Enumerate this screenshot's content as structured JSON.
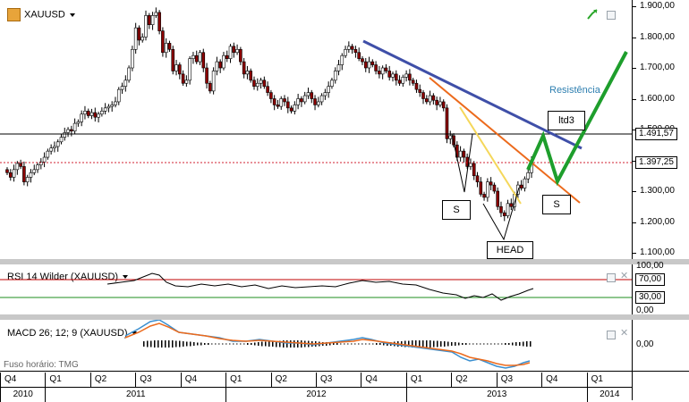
{
  "symbol": "XAUUSD",
  "price_axis": {
    "ticks": [
      {
        "label": "1.900,00",
        "value": 1900
      },
      {
        "label": "1.800,00",
        "value": 1800
      },
      {
        "label": "1.700,00",
        "value": 1700
      },
      {
        "label": "1.600,00",
        "value": 1600
      },
      {
        "label": "1.500,00",
        "value": 1500
      },
      {
        "label": "1.400,00",
        "value": 1400
      },
      {
        "label": "1.300,00",
        "value": 1300
      },
      {
        "label": "1.200,00",
        "value": 1200
      },
      {
        "label": "1.100,00",
        "value": 1100
      }
    ],
    "level_1": "1.491,57",
    "level_2": "1.397,25"
  },
  "annotations": {
    "resistance": "Resistência",
    "ltd": "ltd3",
    "s_left": "S",
    "s_right": "S",
    "head": "HEAD"
  },
  "rsi": {
    "title": "RSI 14 Wilder (XAUUSD)",
    "ticks": [
      "100,00",
      "70,00",
      "30,00",
      "0,00"
    ]
  },
  "macd": {
    "title": "MACD 26; 12; 9 (XAUUSD)",
    "zero_label": "0,00"
  },
  "timezone_label": "Fuso horário: TMG",
  "timeline": {
    "quarters": [
      "Q4",
      "Q1",
      "Q2",
      "Q3",
      "Q4",
      "Q1",
      "Q2",
      "Q3",
      "Q4",
      "Q1",
      "Q2",
      "Q3",
      "Q4",
      "Q1"
    ],
    "years": [
      "2010",
      "2011",
      "2012",
      "2013",
      "2014"
    ]
  },
  "colors": {
    "trend_blue": "#3f4fa8",
    "trend_orange": "#ec6a1c",
    "trend_yellow": "#f5d75a",
    "projection_green": "#1e9e2c",
    "resistance_text": "#2e7fb0",
    "candle_up": "#ffffff",
    "candle_down": "#8b0000",
    "rsi_upper": "#c00000",
    "rsi_lower": "#1e8e1e"
  },
  "chart_data": {
    "type": "candlestick",
    "title": "XAUUSD",
    "xlabel": "",
    "ylabel": "",
    "ylim": [
      1080,
      1920
    ],
    "close": [
      1360,
      1345,
      1370,
      1390,
      1380,
      1330,
      1345,
      1360,
      1370,
      1385,
      1395,
      1410,
      1430,
      1440,
      1445,
      1460,
      1475,
      1490,
      1500,
      1495,
      1520,
      1525,
      1550,
      1560,
      1545,
      1555,
      1540,
      1550,
      1560,
      1570,
      1575,
      1580,
      1590,
      1630,
      1640,
      1660,
      1700,
      1760,
      1830,
      1790,
      1800,
      1870,
      1840,
      1870,
      1880,
      1820,
      1750,
      1780,
      1760,
      1690,
      1710,
      1680,
      1650,
      1660,
      1730,
      1740,
      1720,
      1750,
      1700,
      1650,
      1625,
      1690,
      1720,
      1700,
      1740,
      1730,
      1770,
      1750,
      1760,
      1720,
      1680,
      1690,
      1660,
      1640,
      1650,
      1660,
      1640,
      1620,
      1600,
      1580,
      1575,
      1600,
      1590,
      1570,
      1560,
      1580,
      1600,
      1590,
      1610,
      1620,
      1600,
      1580,
      1590,
      1610,
      1620,
      1640,
      1660,
      1690,
      1710,
      1740,
      1760,
      1770,
      1760,
      1750,
      1730,
      1720,
      1700,
      1720,
      1710,
      1690,
      1680,
      1700,
      1690,
      1670,
      1680,
      1660,
      1650,
      1670,
      1680,
      1660,
      1650,
      1630,
      1620,
      1600,
      1590,
      1610,
      1595,
      1580,
      1590,
      1570,
      1470,
      1480,
      1450,
      1410,
      1430,
      1410,
      1380,
      1390,
      1350,
      1330,
      1290,
      1280,
      1330,
      1320,
      1300,
      1250,
      1230,
      1220,
      1260,
      1250,
      1290,
      1320,
      1310,
      1340,
      1360,
      1397
    ]
  }
}
